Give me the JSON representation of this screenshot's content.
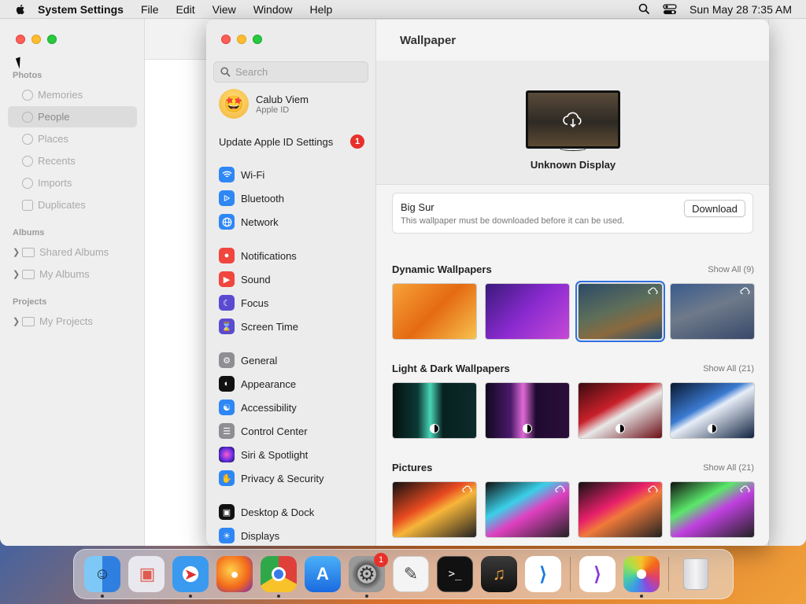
{
  "menubar": {
    "app_name": "System Settings",
    "items": [
      "File",
      "Edit",
      "View",
      "Window",
      "Help"
    ],
    "clock": "Sun May 28  7:35 AM"
  },
  "photos": {
    "sections": [
      "Photos",
      "Albums",
      "Projects"
    ],
    "photos_items": [
      "Memories",
      "People",
      "Places",
      "Recents",
      "Imports",
      "Duplicates"
    ],
    "albums_items": [
      "Shared Albums",
      "My Albums"
    ],
    "projects_items": [
      "My Projects"
    ],
    "selected": "People"
  },
  "settings": {
    "search_placeholder": "Search",
    "user": {
      "name": "Calub Viem",
      "subtitle": "Apple ID"
    },
    "update": {
      "label": "Update Apple ID Settings",
      "badge": "1"
    },
    "items": [
      {
        "label": "Wi-Fi",
        "color": "#2f87f5",
        "icon": "wifi-icon"
      },
      {
        "label": "Bluetooth",
        "color": "#2f87f5",
        "icon": "bluetooth-icon"
      },
      {
        "label": "Network",
        "color": "#2f87f5",
        "icon": "globe-icon"
      },
      {
        "label": "Notifications",
        "color": "#f0463e",
        "icon": "bell-icon"
      },
      {
        "label": "Sound",
        "color": "#f0463e",
        "icon": "speaker-icon"
      },
      {
        "label": "Focus",
        "color": "#5b4bd1",
        "icon": "moon-icon"
      },
      {
        "label": "Screen Time",
        "color": "#5b4bd1",
        "icon": "hourglass-icon"
      },
      {
        "label": "General",
        "color": "#8e8e93",
        "icon": "gear-icon"
      },
      {
        "label": "Appearance",
        "color": "#111111",
        "icon": "appearance-icon"
      },
      {
        "label": "Accessibility",
        "color": "#2f87f5",
        "icon": "accessibility-icon"
      },
      {
        "label": "Control Center",
        "color": "#8e8e93",
        "icon": "toggles-icon"
      },
      {
        "label": "Siri & Spotlight",
        "color": "#c23fd8",
        "icon": "siri-icon"
      },
      {
        "label": "Privacy & Security",
        "color": "#2f87f5",
        "icon": "hand-icon"
      },
      {
        "label": "Desktop & Dock",
        "color": "#111111",
        "icon": "dock-icon"
      },
      {
        "label": "Displays",
        "color": "#2f87f5",
        "icon": "sun-icon"
      }
    ],
    "main": {
      "title": "Wallpaper",
      "display_name": "Unknown Display",
      "current": {
        "name": "Big Sur",
        "desc": "This wallpaper must be downloaded before it can be used.",
        "button": "Download"
      },
      "groups": [
        {
          "title": "Dynamic Wallpapers",
          "show_all": "Show All (9)"
        },
        {
          "title": "Light & Dark Wallpapers",
          "show_all": "Show All (21)"
        },
        {
          "title": "Pictures",
          "show_all": "Show All (21)"
        }
      ]
    }
  },
  "dock": {
    "apps": [
      "Finder",
      "Launchpad",
      "Safari",
      "Firefox",
      "Chrome",
      "App Store",
      "System Settings",
      "TextEdit",
      "Terminal",
      "GarageBand",
      "Visual Studio Code",
      "Visual Studio",
      "Photos",
      "Trash"
    ],
    "settings_badge": "1"
  }
}
